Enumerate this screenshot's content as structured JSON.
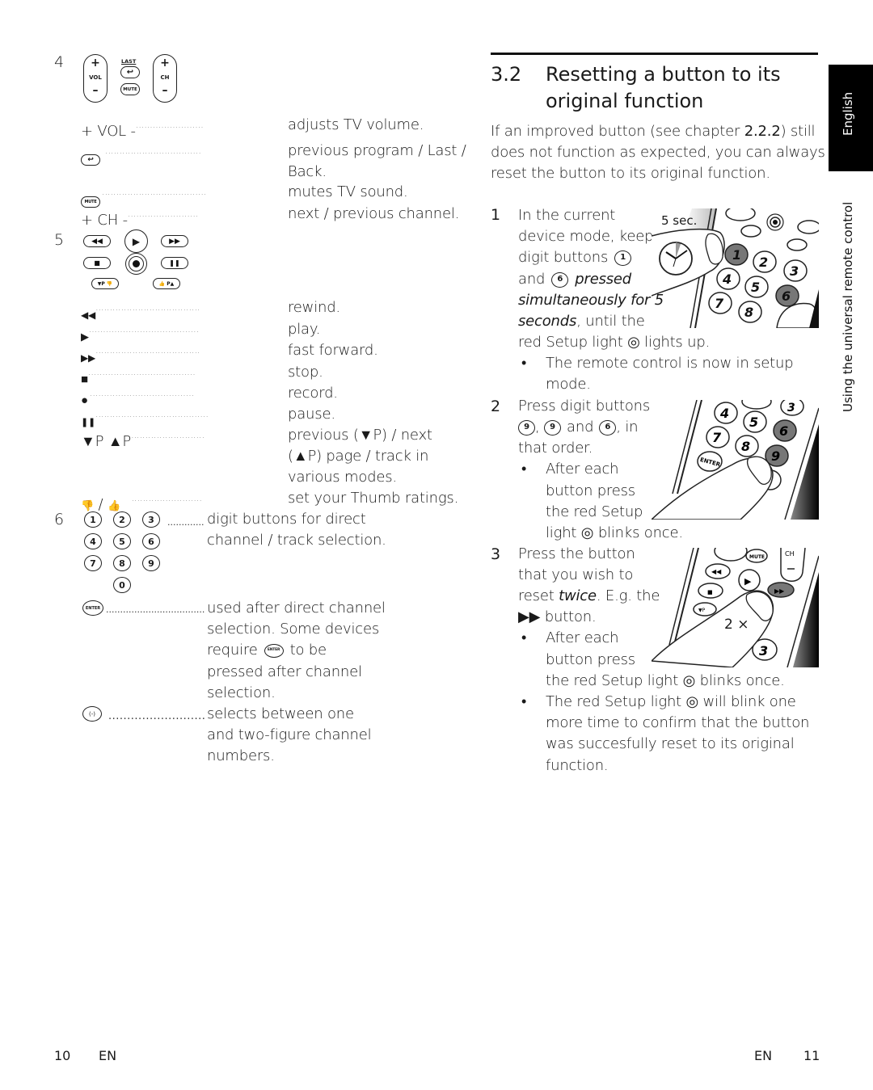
{
  "left_page": {
    "section4": {
      "number": "4",
      "buttons": {
        "vol_plus": "+",
        "vol_label": "VOL",
        "vol_minus": "–",
        "last_label": "LAST",
        "mute_label": "MUTE",
        "ch_plus": "+",
        "ch_label": "CH",
        "ch_minus": "–"
      },
      "rows": [
        {
          "key": "+ VOL -",
          "desc": "adjusts TV volume."
        },
        {
          "key_icon": "last-button-icon",
          "key_label": "LAST",
          "desc": "previous program / Last / Back."
        },
        {
          "key_icon": "mute-button-icon",
          "key_label": "MUTE",
          "desc": "mutes TV sound."
        },
        {
          "key": "+ CH -",
          "desc": "next / previous channel."
        }
      ]
    },
    "section5": {
      "number": "5",
      "buttons": {
        "page_down": "▼P",
        "page_up": "P▲"
      },
      "rows": [
        {
          "key_icon": "rewind-icon",
          "key": "◀◀",
          "desc": "rewind."
        },
        {
          "key_icon": "play-icon",
          "key": "▶",
          "desc": "play."
        },
        {
          "key_icon": "fast-forward-icon",
          "key": "▶▶",
          "desc": "fast forward."
        },
        {
          "key_icon": "stop-icon",
          "key": "■",
          "desc": "stop."
        },
        {
          "key_icon": "record-icon",
          "key": "●",
          "desc": "record."
        },
        {
          "key_icon": "pause-icon",
          "key": "❚❚",
          "desc": "pause."
        },
        {
          "key": "▼P ▲P",
          "desc_lines": [
            "previous (▼P) / next",
            "(▲P) page / track in",
            "various modes."
          ]
        },
        {
          "key_icon": "thumbs-icon",
          "key": "/",
          "desc": "set your Thumb ratings."
        }
      ]
    },
    "section6": {
      "number": "6",
      "digits": [
        "1",
        "2",
        "3",
        "4",
        "5",
        "6",
        "7",
        "8",
        "9",
        "0"
      ],
      "digit_desc_lines": [
        "digit buttons for direct",
        "channel / track selection."
      ],
      "enter_label": "ENTER",
      "enter_desc_lines": [
        "used after direct channel",
        "selection. Some devices"
      ],
      "enter_require_prefix": "require",
      "enter_require_suffix": "to be",
      "enter_desc_tail": [
        "pressed after channel",
        "selection."
      ],
      "dash_label": "(-)",
      "dash_desc_lines": [
        "selects between one",
        "and two-figure channel",
        "numbers."
      ]
    },
    "footer": {
      "page_number": "10",
      "lang": "EN"
    }
  },
  "right_page": {
    "heading": {
      "number": "3.2",
      "title_line1": "Resetting a button to its",
      "title_line2": "original function"
    },
    "intro": {
      "line1_pre": "If an improved button (see chapter ",
      "chapter_ref": "2.2.2",
      "line1_post": ") still",
      "line2": "does not function as expected, you can always",
      "line3": "reset the button to its original function."
    },
    "steps": [
      {
        "number": "1",
        "lines": [
          "In the current",
          "device mode, keep"
        ],
        "digit_line_pre": "digit buttons",
        "digit_a": "1",
        "and": "and",
        "digit_b": "6",
        "italic1": "pressed",
        "italic2": "simultaneously for 5",
        "italic3": "seconds",
        "line_after_italic": ", until the",
        "last_line": "red Setup light ◎ lights up.",
        "bullets": [
          {
            "lines": [
              "The remote control is now in setup",
              "mode."
            ]
          }
        ],
        "illustration": {
          "label": "5 sec.",
          "highlighted_buttons": [
            "1",
            "6"
          ]
        }
      },
      {
        "number": "2",
        "lines": [
          "Press digit buttons"
        ],
        "digits": [
          "9",
          "9",
          "6"
        ],
        "order_text": ", in",
        "and": "and",
        "line3": "that order.",
        "bullets": [
          {
            "lines": [
              "After each",
              "button press",
              "the red Setup",
              "light ◎ blinks once."
            ]
          }
        ],
        "illustration": {
          "highlighted_buttons": [
            "6",
            "9"
          ],
          "enter_label": "ENTER"
        }
      },
      {
        "number": "3",
        "lines": [
          "Press the button",
          "that you wish to"
        ],
        "reset_pre": "reset ",
        "reset_italic": "twice",
        "reset_post": ". E.g. the",
        "ff_button": "▶▶ button.",
        "bullets": [
          {
            "lines": [
              "After each",
              "button press",
              "the red Setup light ◎ blinks once."
            ]
          },
          {
            "lines": [
              "The red Setup light ◎ will blink one",
              "more time to confirm that the button",
              "was succesfully reset to its original",
              "function."
            ]
          }
        ],
        "illustration": {
          "label": "2 ×",
          "mute_label": "MUTE",
          "ch_label": "CH",
          "highlighted_buttons": [
            "▶▶"
          ]
        }
      }
    ],
    "side_tab": {
      "language": "English",
      "chapter": "Using the universal remote control"
    },
    "footer": {
      "lang": "EN",
      "page_number": "11"
    }
  }
}
